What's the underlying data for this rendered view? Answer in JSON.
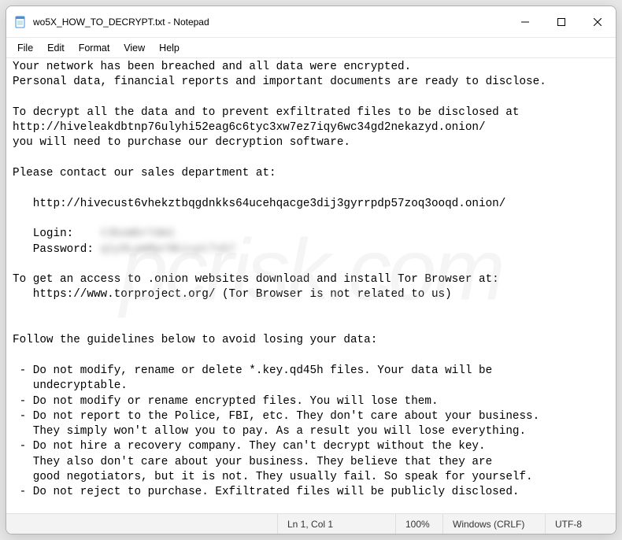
{
  "window": {
    "title": "wo5X_HOW_TO_DECRYPT.txt - Notepad"
  },
  "menu": {
    "items": [
      "File",
      "Edit",
      "Format",
      "View",
      "Help"
    ]
  },
  "body": {
    "line1": "Your network has been breached and all data were encrypted.",
    "line2": "Personal data, financial reports and important documents are ready to disclose.",
    "line3": "",
    "line4": "To decrypt all the data and to prevent exfiltrated files to be disclosed at",
    "line5": "http://hiveleakdbtnp76ulyhi52eag6c6tyc3xw7ez7iqy6wc34gd2nekazyd.onion/",
    "line6": "you will need to purchase our decryption software.",
    "line7": "",
    "line8": "Please contact our sales department at:",
    "line9": "",
    "line10": "   http://hivecust6vhekztbqgdnkks64ucehqacge3dij3gyrrpdp57zoq3ooqd.onion/",
    "line11": "",
    "login_label": "   Login:    ",
    "login_value": "t3bsWbrYdm1",
    "password_label": "   Password: ",
    "password_value": "q1y9LpmRprNkicpt7vb7",
    "line14": "",
    "line15": "To get an access to .onion websites download and install Tor Browser at:",
    "line16": "   https://www.torproject.org/ (Tor Browser is not related to us)",
    "line17": "",
    "line18": "",
    "line19": "Follow the guidelines below to avoid losing your data:",
    "line20": "",
    "line21": " - Do not modify, rename or delete *.key.qd45h files. Your data will be",
    "line22": "   undecryptable.",
    "line23": " - Do not modify or rename encrypted files. You will lose them.",
    "line24": " - Do not report to the Police, FBI, etc. They don't care about your business.",
    "line25": "   They simply won't allow you to pay. As a result you will lose everything.",
    "line26": " - Do not hire a recovery company. They can't decrypt without the key.",
    "line27": "   They also don't care about your business. They believe that they are",
    "line28": "   good negotiators, but it is not. They usually fail. So speak for yourself.",
    "line29": " - Do not reject to purchase. Exfiltrated files will be publicly disclosed."
  },
  "status": {
    "position": "Ln 1, Col 1",
    "zoom": "100%",
    "lineending": "Windows (CRLF)",
    "encoding": "UTF-8"
  },
  "watermark": "pcrisk.com"
}
